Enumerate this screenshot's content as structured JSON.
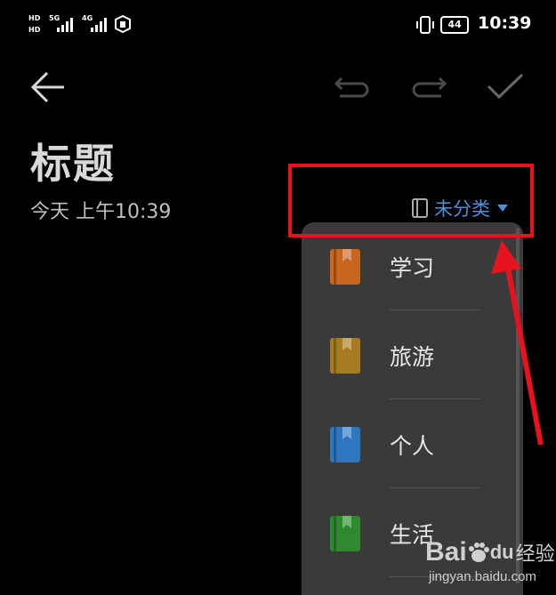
{
  "status_bar": {
    "hd1": "HD",
    "hd2": "HD",
    "net1": "5G",
    "net2": "4G",
    "battery": "44",
    "time": "10:39"
  },
  "toolbar": {
    "back_icon": "arrow-left-icon",
    "undo_icon": "undo-icon",
    "redo_icon": "redo-icon",
    "confirm_icon": "check-icon"
  },
  "note": {
    "title": "标题",
    "date": "今天 上午10:39",
    "category": "未分类"
  },
  "category_menu": {
    "items": [
      {
        "label": "学习",
        "color": "#c8651f"
      },
      {
        "label": "旅游",
        "color": "#a67c23"
      },
      {
        "label": "个人",
        "color": "#2f76c0"
      },
      {
        "label": "生活",
        "color": "#2f8a2f"
      }
    ]
  },
  "annotation": {
    "box_color": "#e8121e"
  },
  "watermark": {
    "baidu": "Bai",
    "paw": "du",
    "jingyan": "经验",
    "url": "jingyan.baidu.com"
  }
}
